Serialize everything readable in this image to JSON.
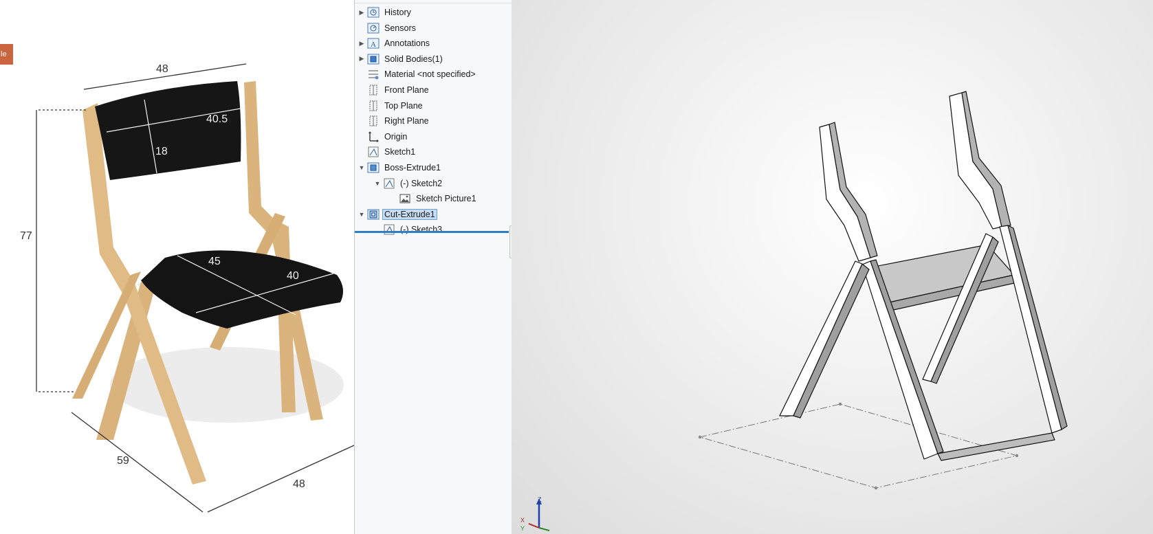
{
  "photo": {
    "tab_label": "le",
    "dimensions": {
      "backrest_top_width": "48",
      "backrest_pad_width": "40.5",
      "backrest_pad_height": "18",
      "overall_height": "77",
      "seat_depth": "45",
      "seat_width": "40",
      "base_depth": "59",
      "base_width": "48"
    }
  },
  "feature_tree": {
    "items": [
      {
        "label": "History",
        "icon": "history-icon",
        "expander": "collapsed",
        "indent": 0
      },
      {
        "label": "Sensors",
        "icon": "sensors-icon",
        "expander": "none",
        "indent": 0
      },
      {
        "label": "Annotations",
        "icon": "annotations-icon",
        "expander": "collapsed",
        "indent": 0
      },
      {
        "label": "Solid Bodies(1)",
        "icon": "solid-bodies-icon",
        "expander": "collapsed",
        "indent": 0
      },
      {
        "label": "Material <not specified>",
        "icon": "material-icon",
        "expander": "none",
        "indent": 0
      },
      {
        "label": "Front Plane",
        "icon": "plane-icon",
        "expander": "none",
        "indent": 0
      },
      {
        "label": "Top Plane",
        "icon": "plane-icon",
        "expander": "none",
        "indent": 0
      },
      {
        "label": "Right Plane",
        "icon": "plane-icon",
        "expander": "none",
        "indent": 0
      },
      {
        "label": "Origin",
        "icon": "origin-icon",
        "expander": "none",
        "indent": 0
      },
      {
        "label": "Sketch1",
        "icon": "sketch-icon",
        "expander": "none",
        "indent": 0
      },
      {
        "label": "Boss-Extrude1",
        "icon": "boss-extrude-icon",
        "expander": "expanded",
        "indent": 0
      },
      {
        "label": "(-) Sketch2",
        "icon": "sketch-icon",
        "expander": "expanded",
        "indent": 1
      },
      {
        "label": "Sketch Picture1",
        "icon": "sketch-picture-icon",
        "expander": "none",
        "indent": 2
      },
      {
        "label": "Cut-Extrude1",
        "icon": "cut-extrude-icon",
        "expander": "expanded",
        "indent": 0,
        "selected": true
      },
      {
        "label": "(-) Sketch3",
        "icon": "sketch-icon",
        "expander": "none",
        "indent": 1
      }
    ]
  },
  "viewport": {
    "triad_z_label": "Z",
    "triad_x_label": "X",
    "triad_y_label": "Y"
  }
}
